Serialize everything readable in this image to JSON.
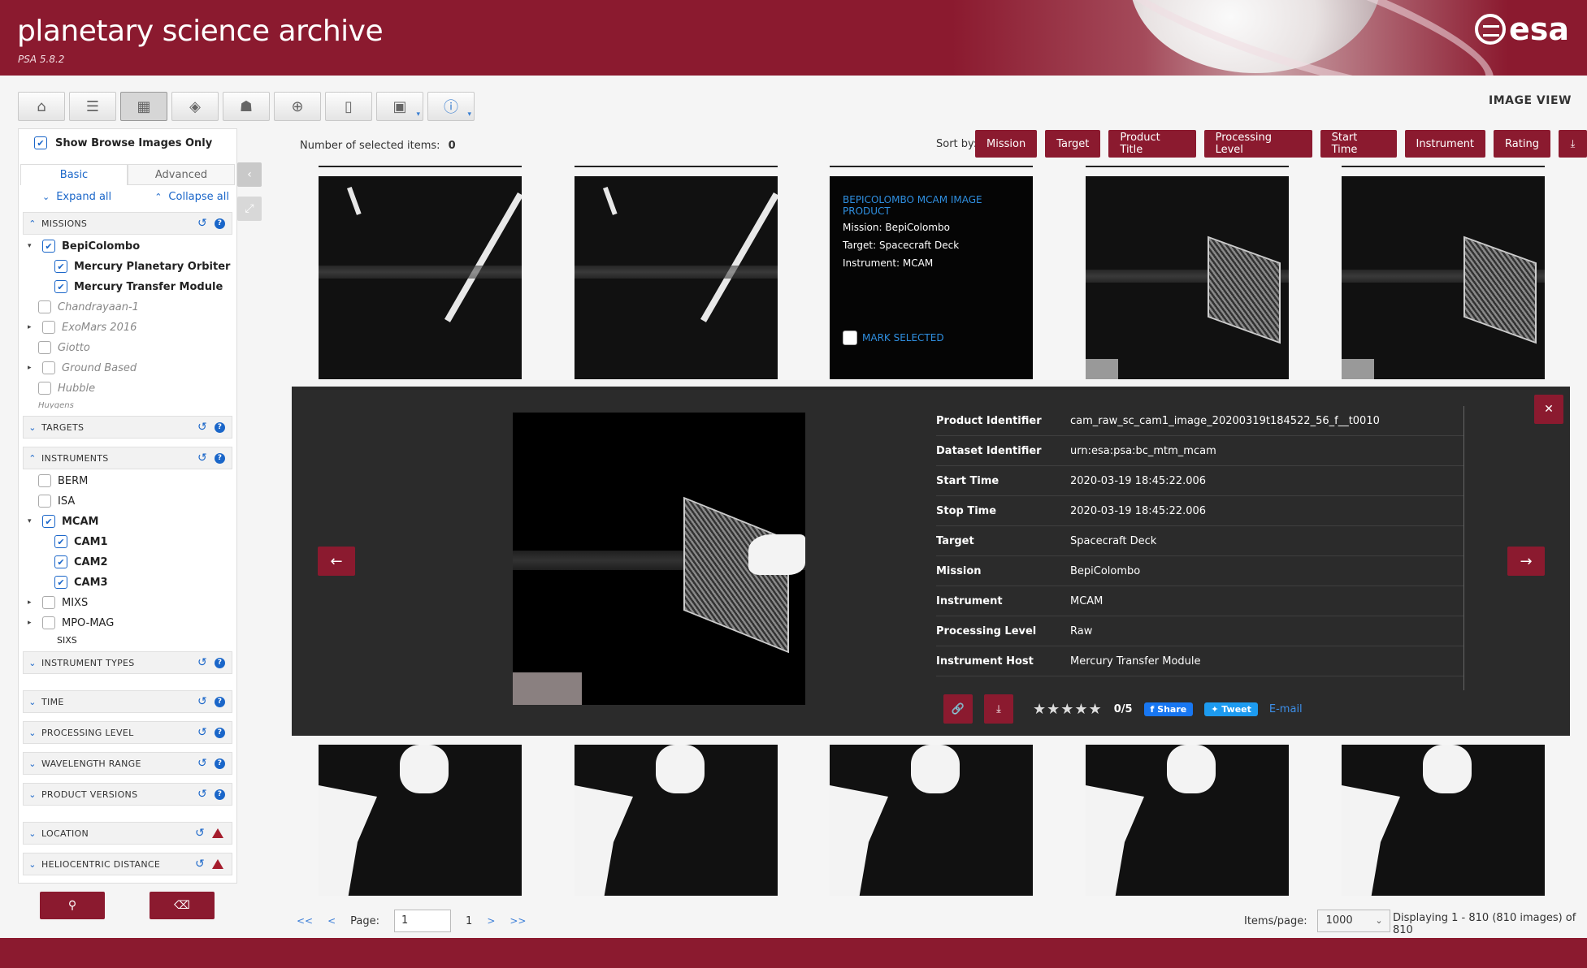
{
  "header": {
    "title": "planetary science archive",
    "version": "PSA 5.8.2",
    "logo_text": "esa"
  },
  "toolbar": {
    "buttons": [
      "home-icon",
      "list-icon",
      "image-view-icon",
      "map-icon",
      "rocks-icon",
      "download-icon",
      "scroll-icon",
      "box-icon",
      "info-icon"
    ],
    "view_label": "IMAGE VIEW"
  },
  "sidebar": {
    "show_browse_label": "Show Browse Images Only",
    "tab_basic": "Basic",
    "tab_advanced": "Advanced",
    "expand_all": "Expand all",
    "collapse_all": "Collapse all",
    "sections": {
      "missions": "MISSIONS",
      "targets": "TARGETS",
      "instruments": "INSTRUMENTS",
      "instrument_types": "INSTRUMENT TYPES",
      "time": "TIME",
      "processing_level": "PROCESSING LEVEL",
      "wavelength_range": "WAVELENGTH RANGE",
      "product_versions": "PRODUCT VERSIONS",
      "location": "LOCATION",
      "heliocentric_distance": "HELIOCENTRIC DISTANCE"
    },
    "missions": [
      "BepiColombo",
      "Mercury Planetary Orbiter",
      "Mercury Transfer Module",
      "Chandrayaan-1",
      "ExoMars 2016",
      "Giotto",
      "Ground Based",
      "Hubble",
      "Huygens"
    ],
    "instruments": [
      "BERM",
      "ISA",
      "MCAM",
      "CAM1",
      "CAM2",
      "CAM3",
      "MIXS",
      "MPO-MAG",
      "SIXS"
    ]
  },
  "main": {
    "selected_label": "Number of selected items:",
    "selected_count": "0",
    "sort_label": "Sort by:",
    "sort_buttons": [
      "Mission",
      "Target",
      "Product Title",
      "Processing Level",
      "Start Time",
      "Instrument",
      "Rating"
    ]
  },
  "info_thumb": {
    "title": "BEPICOLOMBO MCAM IMAGE PRODUCT",
    "mission": "Mission: BepiColombo",
    "target": "Target: Spacecraft Deck",
    "instrument": "Instrument: MCAM",
    "mark": "MARK SELECTED"
  },
  "detail": {
    "rows": [
      {
        "k": "Product Identifier",
        "v": "cam_raw_sc_cam1_image_20200319t184522_56_f__t0010"
      },
      {
        "k": "Dataset Identifier",
        "v": "urn:esa:psa:bc_mtm_mcam"
      },
      {
        "k": "Start Time",
        "v": "2020-03-19 18:45:22.006"
      },
      {
        "k": "Stop Time",
        "v": "2020-03-19 18:45:22.006"
      },
      {
        "k": "Target",
        "v": "Spacecraft Deck"
      },
      {
        "k": "Mission",
        "v": "BepiColombo"
      },
      {
        "k": "Instrument",
        "v": "MCAM"
      },
      {
        "k": "Processing Level",
        "v": "Raw"
      },
      {
        "k": "Instrument Host",
        "v": "Mercury Transfer Module"
      }
    ],
    "stars": "★★★★★",
    "rating": "0/5",
    "share": "Share",
    "tweet": "Tweet",
    "email": "E-mail"
  },
  "pagination": {
    "first": "<<",
    "prev": "<",
    "page_label": "Page:",
    "page_value": "1",
    "total_pages": "1",
    "next": ">",
    "last": ">>",
    "items_label": "Items/page:",
    "items_value": "1000",
    "displaying": "Displaying 1 - 810 (810 images) of 810"
  }
}
